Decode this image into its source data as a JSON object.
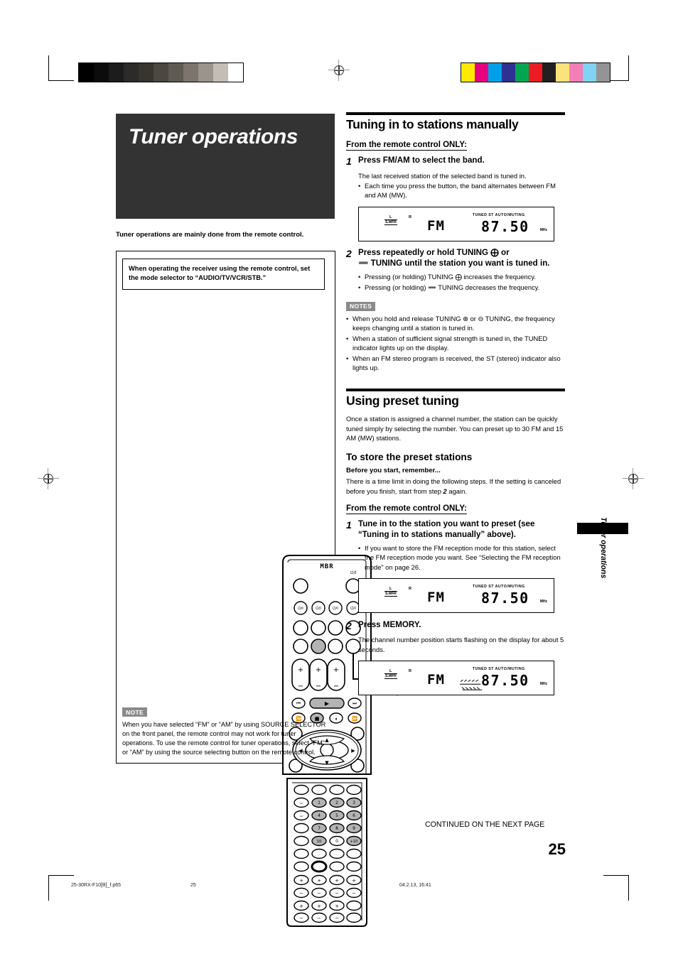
{
  "page": {
    "number": "25",
    "continued": "CONTINUED ON THE NEXT PAGE",
    "side_tab": "Tuner operations"
  },
  "footer": {
    "filename": "25-30RX-F10[B]_f.p65",
    "page": "25",
    "timestamp": "04.2.13, 16:41"
  },
  "left": {
    "chapter_title": "Tuner operations",
    "lead": "Tuner operations are mainly done from the remote control.",
    "mode_box": "When operating the receiver using the remote control, set the mode selector to “AUDIO/TV/VCR/STB.”",
    "note_tag": "NOTE",
    "note_body": "When you have selected “FM” or “AM” by using SOURCE SELECTOR on the front panel, the remote control may not work for tuner operations. To use the remote control for tuner operations, select “FM” or “AM” by using the source selecting button on the remote control.",
    "remote": {
      "brand": "MBR",
      "power_glyph": "⏻/I",
      "mode_selector_label": "⌐⌐",
      "keypad": [
        "1",
        "2",
        "3",
        "4",
        "5",
        "6",
        "7",
        "8",
        "9",
        "10",
        "0",
        "+10"
      ],
      "transport": [
        "⏮",
        "▶",
        "⏭",
        "⏪",
        "■",
        "⏸",
        "⏩"
      ],
      "dpad": [
        "▲",
        "◀",
        "▶",
        "▼"
      ],
      "plus": "+",
      "minus": "−"
    }
  },
  "section1": {
    "heading": "Tuning in to stations manually",
    "subhead": "From the remote control ONLY:",
    "step1": {
      "num": "1",
      "text": "Press FM/AM to select the band.",
      "body": "The last received station of the selected band is tuned in.",
      "bullet": "Each time you press the button, the band alternates between FM and AM (MW)."
    },
    "step2": {
      "num": "2",
      "text_a": "Press repeatedly or hold TUNING",
      "text_b": "or",
      "text_c": "TUNING until the station you want is tuned in.",
      "bullet1_a": "Pressing (or holding) TUNING",
      "bullet1_b": "increases the frequency.",
      "bullet2_a": "Pressing (or holding)",
      "bullet2_b": "TUNING decreases the frequency."
    },
    "notes_tag": "NOTES",
    "notes": [
      "When you hold and release TUNING ⊕ or ⊖ TUNING, the frequency keeps changing until a station is tuned in.",
      "When a station of sufficient signal strength is tuned in, the TUNED indicator lights up on the display.",
      "When an FM stereo program is received, the ST (stereo) indicator also lights up."
    ]
  },
  "section2": {
    "heading": "Using preset tuning",
    "intro": "Once a station is assigned a channel number, the station can be quickly tuned simply by selecting the number. You can preset up to 30 FM and 15 AM (MW) stations.",
    "subheading": "To store the preset stations",
    "before_title": "Before you start, remember...",
    "before_body_a": "There is a time limit in doing the following steps. If the setting is canceled before you finish, start from step",
    "before_body_step": "2",
    "before_body_b": "again.",
    "subhead": "From the remote control ONLY:",
    "step1": {
      "num": "1",
      "text": "Tune in to the station you want to preset (see “Tuning in to stations manually” above).",
      "bullet": "If you want to store the FM reception mode for this station, select the FM reception mode you want. See “Selecting the FM reception mode” on page 26."
    },
    "step2": {
      "num": "2",
      "text": "Press MEMORY.",
      "body": "The channel number position starts flashing on the display for about 5 seconds."
    }
  },
  "lcd": {
    "left_channel": "L",
    "subwoofer": "S.WFR",
    "right_channel": "R",
    "band": "FM",
    "indicators": "TUNED  ST  AUTO/MUTING",
    "frequency": "87.50",
    "unit": "MHz"
  },
  "colors": {
    "gray_ramp": [
      "#000000",
      "#0c0c0c",
      "#1c1c1c",
      "#2c2b29",
      "#38352f",
      "#4b4741",
      "#5f5a53",
      "#7c756d",
      "#9b948c",
      "#c3bdb6",
      "#ffffff"
    ],
    "color_ramp": [
      "#ffe800",
      "#e6007e",
      "#00a0e9",
      "#2e3192",
      "#00a650",
      "#ed1c24",
      "#231f20",
      "#fbe27a",
      "#f47fb6",
      "#7fd3f3",
      "#949494"
    ],
    "band_bg": "#333333",
    "tag_bg": "#8a8a8a",
    "button_gray": "#b3b3b3"
  }
}
